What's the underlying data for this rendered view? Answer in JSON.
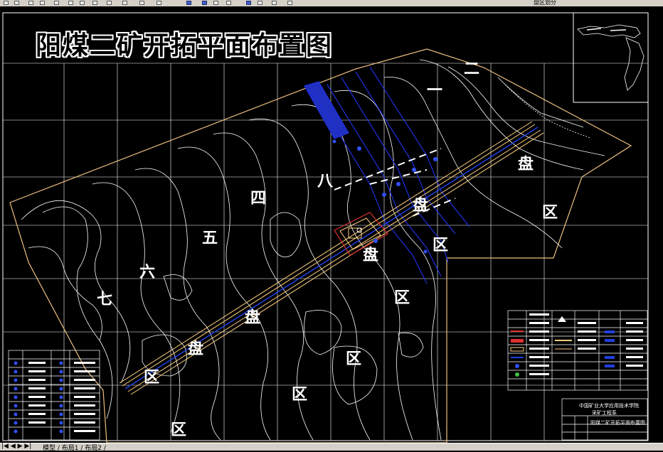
{
  "toolbar": {
    "right_label": "盘区划分",
    "icons": [
      "new-icon",
      "open-icon",
      "save-icon",
      "print-icon",
      "cut-icon",
      "copy-icon",
      "paste-icon",
      "undo-icon",
      "redo-icon",
      "pan-icon",
      "zoom-icon",
      "layer-icon",
      "properties-icon",
      "block-icon",
      "insert-icon",
      "hatch-icon",
      "text-icon",
      "dimension-icon",
      "measure-icon",
      "color-icon"
    ]
  },
  "drawing": {
    "title": "阳煤二矿开拓平面布置图",
    "regions": [
      {
        "text": "二"
      },
      {
        "text": "一"
      },
      {
        "text": "盘"
      },
      {
        "text": "区"
      },
      {
        "text": "八"
      },
      {
        "text": "盘"
      },
      {
        "text": "区"
      },
      {
        "text": "四"
      },
      {
        "text": "盘"
      },
      {
        "text": "五"
      },
      {
        "text": "盘"
      },
      {
        "text": "区"
      },
      {
        "text": "六"
      },
      {
        "text": "七"
      },
      {
        "text": "盘"
      },
      {
        "text": "区"
      },
      {
        "text": "区"
      },
      {
        "text": "区"
      },
      {
        "text": "区"
      }
    ],
    "title_block": {
      "line1": "中国矿业大学应用技术学院",
      "line2": "采矿工程系",
      "drawing_name": "阳煤二矿开拓平面布置图"
    }
  },
  "statusbar": {
    "nav": "|◀ ◀ ▶ ▶|",
    "tabs": "模型 / 布局1 / 布局2 /"
  },
  "colors": {
    "background": "#000000",
    "grid": "#ffffff",
    "boundary": "#f0c080",
    "roadway": "#ffd080",
    "seam": "#2030e0",
    "chrome": "#d4d0c8"
  }
}
